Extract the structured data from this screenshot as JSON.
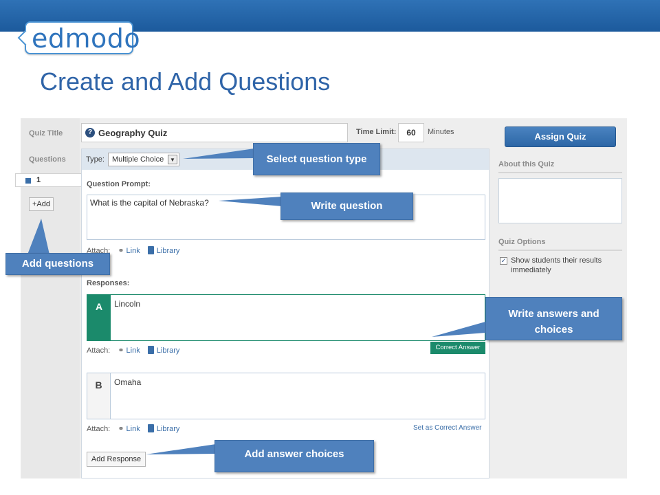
{
  "slide": {
    "logo_text": "edmodo",
    "title": "Create and Add Questions"
  },
  "sidebar": {
    "quiz_title_label": "Quiz Title",
    "questions_label": "Questions",
    "question_tab": "1",
    "add_button": "+Add"
  },
  "quiz": {
    "title_value": "Geography Quiz",
    "help_icon": "?",
    "time_limit_label": "Time Limit:",
    "time_limit_value": "60",
    "time_limit_unit": "Minutes",
    "type_label": "Type:",
    "type_value": "Multiple Choice",
    "question_prompt_label": "Question Prompt:",
    "question_prompt_value": "What is the capital of Nebraska?",
    "responses_label": "Responses:",
    "attach_label": "Attach:",
    "link_label": "Link",
    "library_label": "Library",
    "responses": [
      {
        "letter": "A",
        "text": "Lincoln",
        "correct": true
      },
      {
        "letter": "B",
        "text": "Omaha",
        "correct": false
      }
    ],
    "correct_answer_badge": "Correct Answer",
    "set_correct_label": "Set as Correct Answer",
    "add_response_button": "Add Response"
  },
  "right_panel": {
    "assign_button": "Assign Quiz",
    "about_label": "About this Quiz",
    "options_label": "Quiz Options",
    "show_results_label": "Show students their results immediately",
    "show_results_checked": true
  },
  "callouts": {
    "select_type": "Select question type",
    "write_question": "Write question",
    "add_questions": "Add questions",
    "write_answers": "Write answers and choices",
    "add_choices": "Add answer choices"
  },
  "colors": {
    "topbar": "#1c5a9c",
    "title": "#2f64a8",
    "callout": "#4f81bd",
    "correct_green": "#1b8a6b",
    "link_blue": "#3a6ea8"
  }
}
